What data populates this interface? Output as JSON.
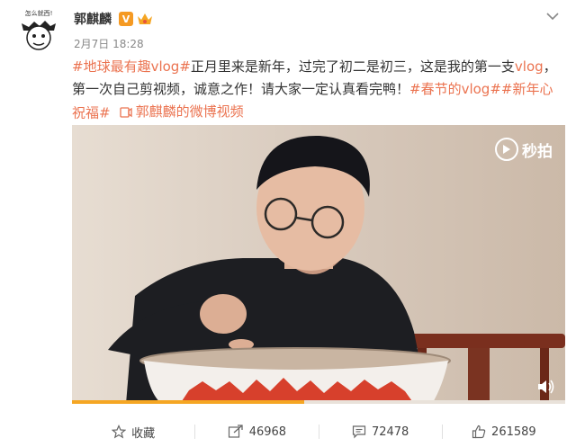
{
  "post": {
    "avatar_caption": "怎么就西!",
    "username": "郭麒麟",
    "vip_mark": "V",
    "timestamp": "2月7日 18:28",
    "text": {
      "tag1": "#地球最有趣vlog#",
      "body1": "正月里来是新年，过完了初二是初三，这是我的第一支",
      "vlog_word": "vlog",
      "body2": "，第一次自己剪视频，诚意之作！请大家一定认真看完鸭！",
      "tag2": "#春节的vlog#",
      "tag3": "#新年心祝福#",
      "video_link": "郭麒麟的微博视频"
    }
  },
  "video": {
    "watermark": "秒拍",
    "progress": 0.47
  },
  "actions": {
    "favorite": "收藏",
    "repost_count": "46968",
    "comment_count": "72478",
    "like_count": "261589"
  },
  "colors": {
    "accent": "#eb7350",
    "progress": "#f5a623",
    "vip": "#f59a23"
  }
}
